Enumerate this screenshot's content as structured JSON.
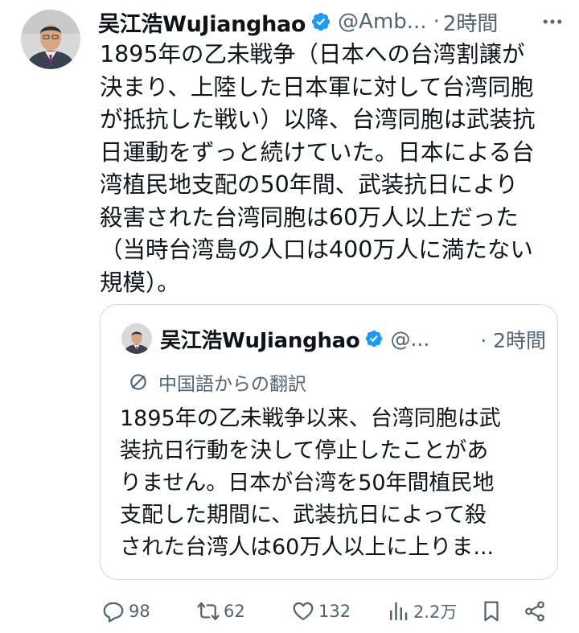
{
  "tweet": {
    "author_name": "吴江浩WuJianghao",
    "handle": "@Amb...",
    "separator": "·",
    "time": "2時間",
    "text": "1895年の乙未戦争（日本への台湾割譲が\n決まり、上陸した日本軍に対して台湾同胞\nが抵抗した戦い）以降、台湾同胞は武装抗\n日運動をずっと続けていた。日本による台\n湾植民地支配の50年間、武装抗日により\n殺害された台湾同胞は60万人以上だった\n（当時台湾島の人口は400万人に満たない\n規模）。"
  },
  "quote": {
    "author_name": "吴江浩WuJianghao",
    "handle": "@...",
    "time": "· 2時間",
    "translation_label": "中国語からの翻訳",
    "text": "1895年の乙未戦争以来、台湾同胞は武\n装抗日行動を決して停止したことがあ\nりません。日本が台湾を50年間植民地\n支配した期間に、武装抗日によって殺\nされた台湾人は60万人以上に上りま..."
  },
  "actions": {
    "replies": "98",
    "retweets": "62",
    "likes": "132",
    "views": "2.2万"
  },
  "icons": {
    "verified": "verified-badge-icon",
    "more": "more-dots-icon",
    "translate": "translate-icon",
    "reply": "reply-bubble-icon",
    "retweet": "retweet-arrows-icon",
    "like": "heart-icon",
    "views": "bar-chart-icon",
    "bookmark": "bookmark-icon",
    "share": "share-icon"
  },
  "colors": {
    "text_primary": "#0f1419",
    "text_secondary": "#536471",
    "verified_blue": "#1d9bf0",
    "border": "#cfd9de"
  }
}
